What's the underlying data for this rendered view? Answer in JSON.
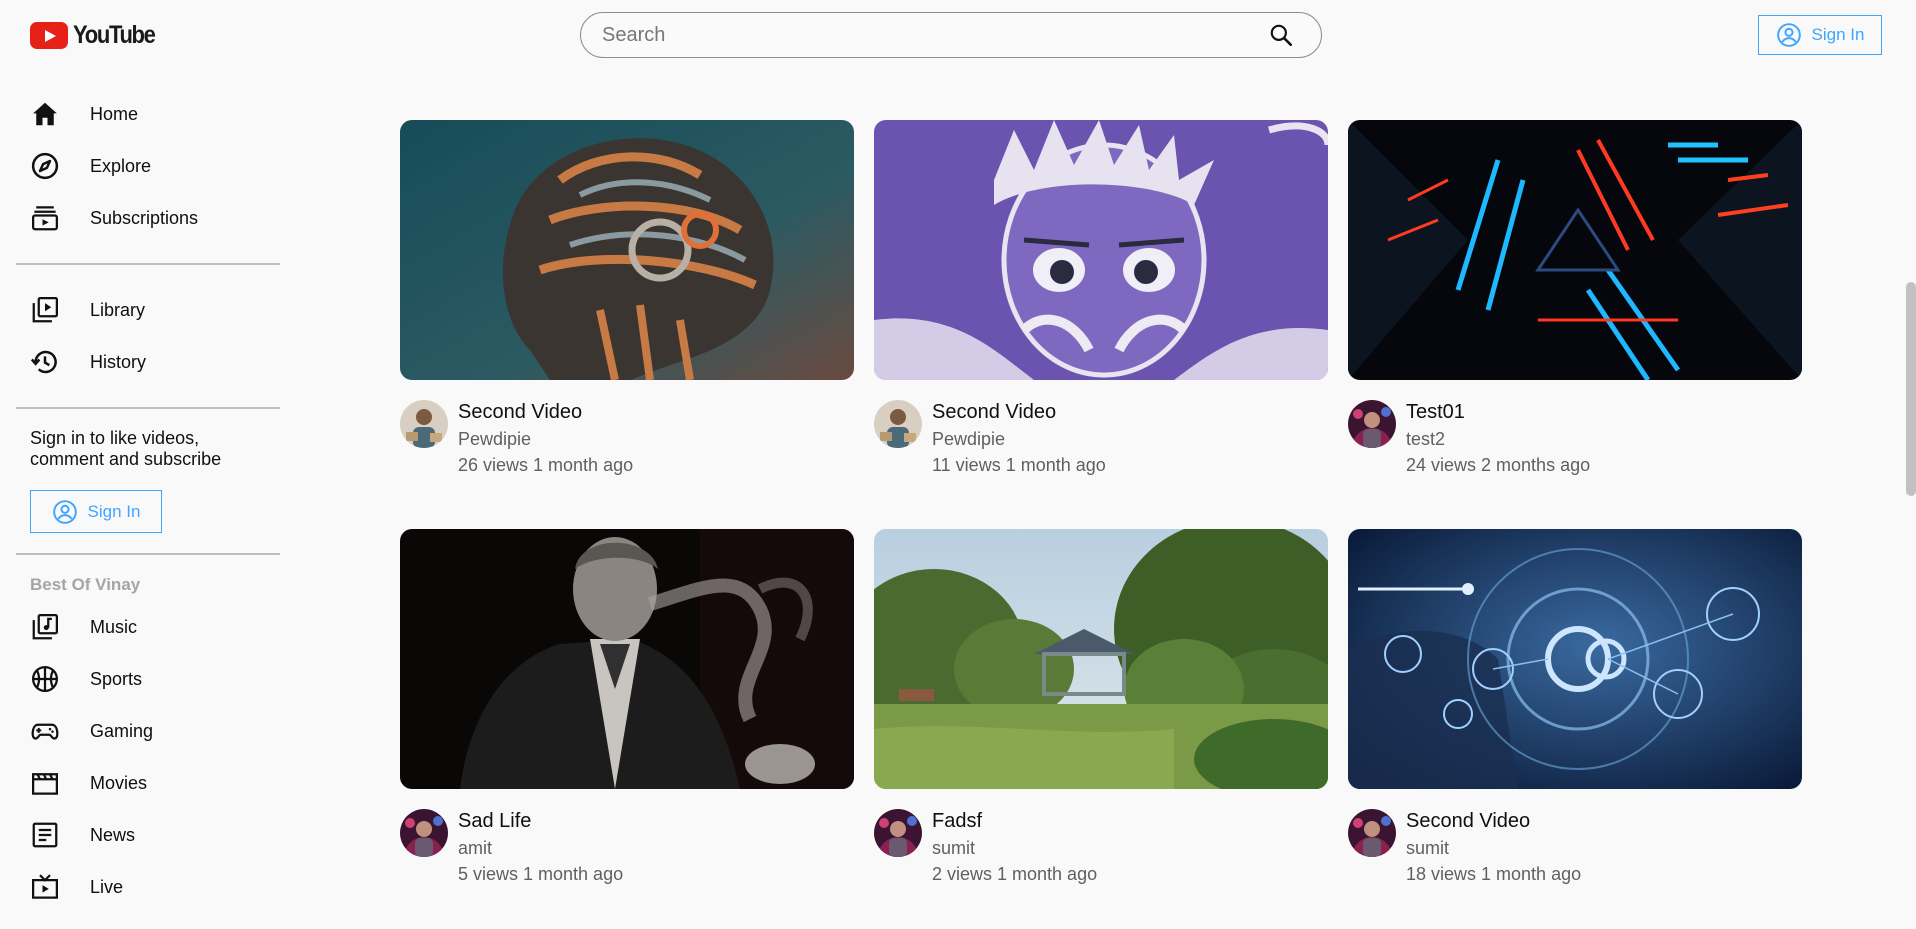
{
  "header": {
    "logo_text": "YouTube",
    "search_placeholder": "Search",
    "signin_label": "Sign In"
  },
  "sidebar": {
    "primary": [
      {
        "label": "Home",
        "icon": "home-icon"
      },
      {
        "label": "Explore",
        "icon": "compass-icon"
      },
      {
        "label": "Subscriptions",
        "icon": "subscriptions-icon"
      }
    ],
    "secondary": [
      {
        "label": "Library",
        "icon": "library-icon"
      },
      {
        "label": "History",
        "icon": "history-icon"
      }
    ],
    "signin_message": "Sign in to like videos, comment and subscribe",
    "signin_label": "Sign In",
    "section_title": "Best Of Vinay",
    "categories": [
      {
        "label": "Music",
        "icon": "music-icon"
      },
      {
        "label": "Sports",
        "icon": "sports-icon"
      },
      {
        "label": "Gaming",
        "icon": "gaming-icon"
      },
      {
        "label": "Movies",
        "icon": "movies-icon"
      },
      {
        "label": "News",
        "icon": "news-icon"
      },
      {
        "label": "Live",
        "icon": "live-icon"
      }
    ]
  },
  "videos": [
    {
      "title": "Second Video",
      "channel": "Pewdipie",
      "stats": "26 views 1 month ago"
    },
    {
      "title": "Second Video",
      "channel": "Pewdipie",
      "stats": "11 views 1 month ago"
    },
    {
      "title": "Test01",
      "channel": "test2",
      "stats": "24 views 2 months ago"
    },
    {
      "title": "Sad Life",
      "channel": "amit",
      "stats": "5 views 1 month ago"
    },
    {
      "title": "Fadsf",
      "channel": "sumit",
      "stats": "2 views 1 month ago"
    },
    {
      "title": "Second Video",
      "channel": "sumit",
      "stats": "18 views 1 month ago"
    }
  ],
  "colors": {
    "accent": "#3ea6ff",
    "logo_red": "#e62117"
  }
}
